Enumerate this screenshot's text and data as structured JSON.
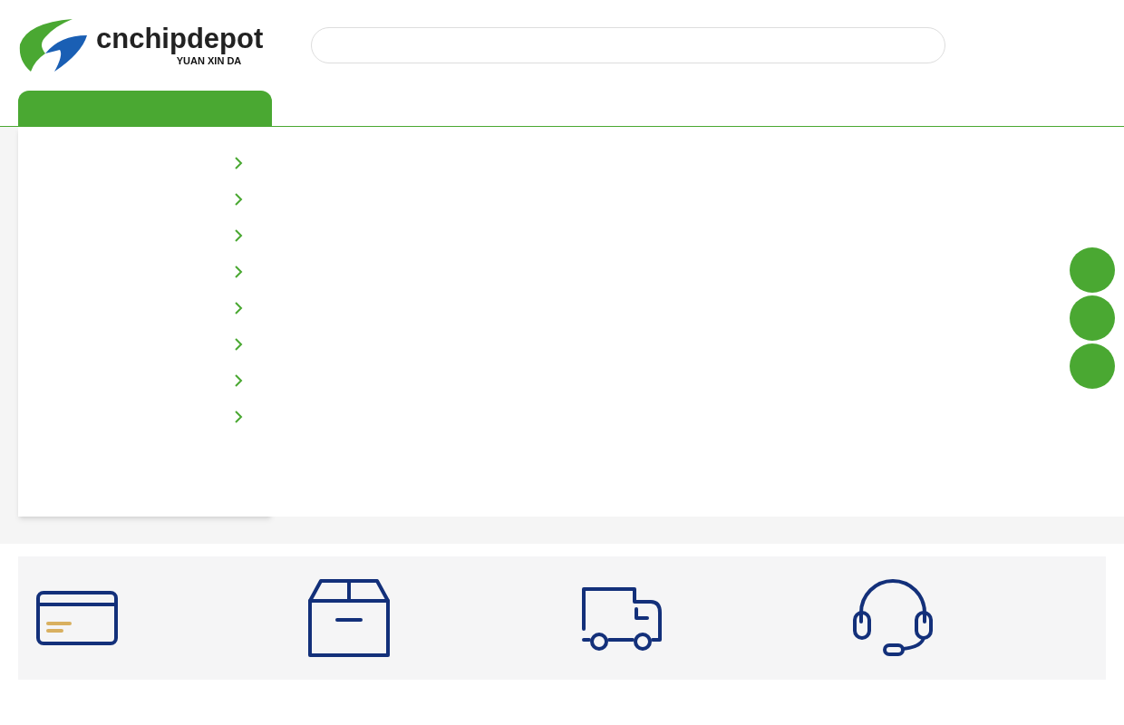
{
  "logo": {
    "name": "cnchipdepot",
    "tagline": "YUAN XIN DA"
  },
  "category_menu": {
    "items": [
      {
        "kind": "category"
      },
      {
        "kind": "category"
      },
      {
        "kind": "category"
      },
      {
        "kind": "category"
      },
      {
        "kind": "category"
      },
      {
        "kind": "category"
      },
      {
        "kind": "category"
      },
      {
        "kind": "category"
      }
    ]
  },
  "side_buttons": [
    {
      "kind": "round"
    },
    {
      "kind": "round"
    },
    {
      "kind": "round"
    }
  ],
  "features": [
    {
      "kind": "card"
    },
    {
      "kind": "box"
    },
    {
      "kind": "truck"
    },
    {
      "kind": "headset"
    }
  ]
}
